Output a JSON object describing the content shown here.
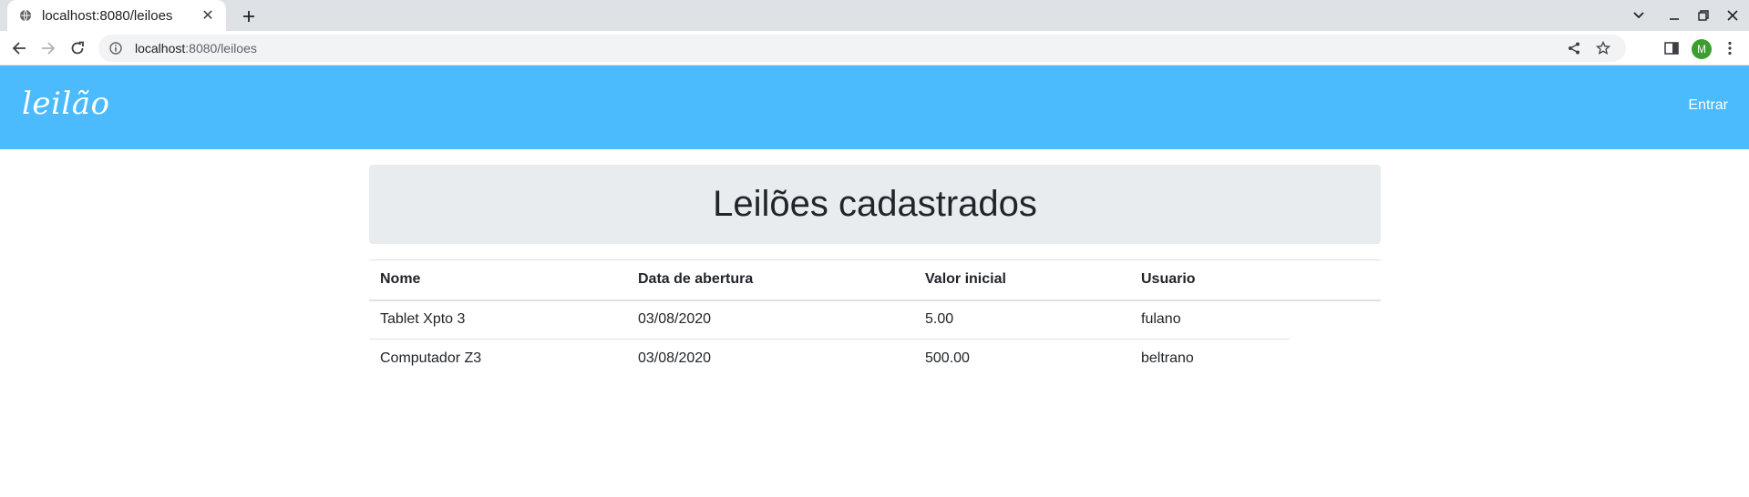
{
  "browser": {
    "tab_title": "localhost:8080/leiloes",
    "url_host": "localhost",
    "url_path": ":8080/leiloes",
    "profile_initial": "M"
  },
  "navbar": {
    "brand": "leilão",
    "login_label": "Entrar",
    "background_color": "#4bbbfd"
  },
  "page": {
    "heading": "Leilões cadastrados"
  },
  "table": {
    "headers": {
      "nome": "Nome",
      "data": "Data de abertura",
      "valor": "Valor inicial",
      "usuario": "Usuario"
    },
    "rows": [
      {
        "nome": "Tablet Xpto 3",
        "data": "03/08/2020",
        "valor": "5.00",
        "usuario": "fulano"
      },
      {
        "nome": "Computador Z3",
        "data": "03/08/2020",
        "valor": "500.00",
        "usuario": "beltrano"
      }
    ]
  }
}
